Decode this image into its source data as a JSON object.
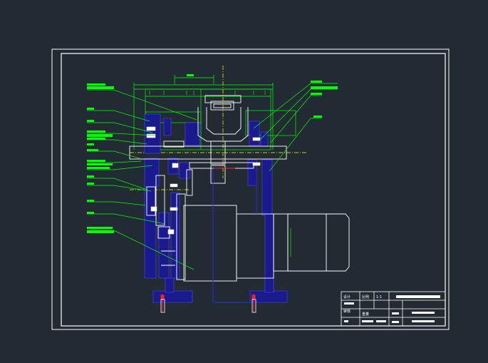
{
  "colors": {
    "background": "#222a33",
    "frame": "#ffffff",
    "annotation": "#00ff00",
    "solid_part": "#1a1a8c",
    "blue_line": "#2a2ae0",
    "red_line": "#ff2020",
    "yellow_line": "#ffff00"
  },
  "title_block": {
    "scale_label": "比例",
    "scale_value": "1:1",
    "design_label": "设计",
    "check_label": "审核",
    "weight_label": "重量"
  }
}
